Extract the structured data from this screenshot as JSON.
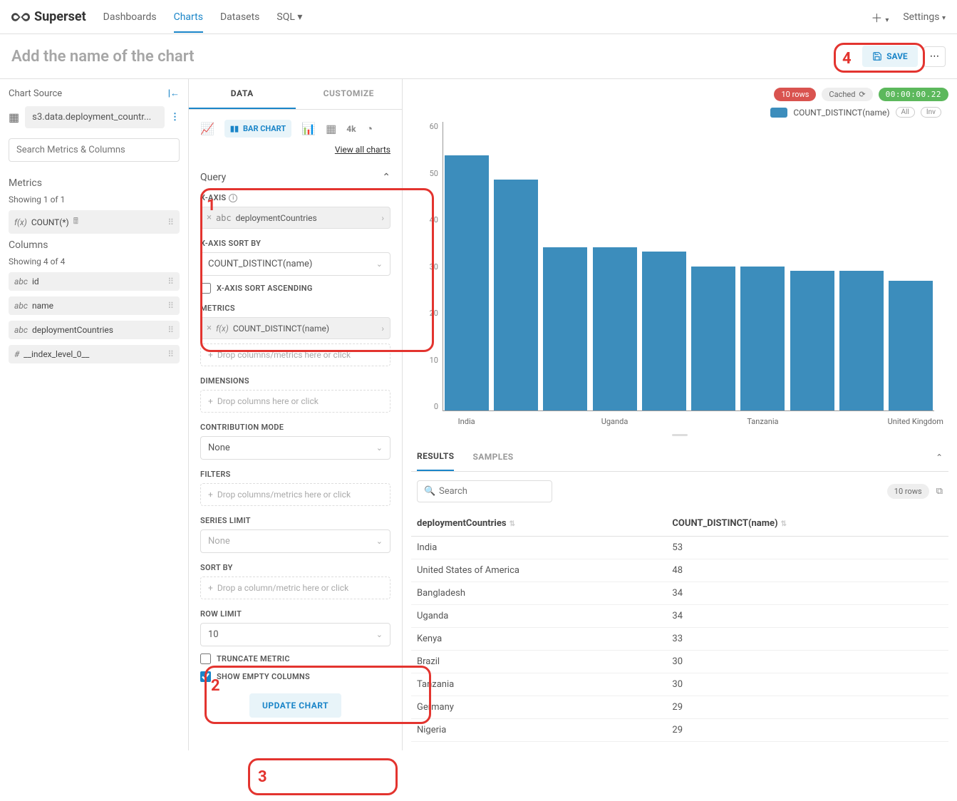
{
  "brand": "Superset",
  "nav": {
    "items": [
      "Dashboards",
      "Charts",
      "Datasets",
      "SQL"
    ],
    "active": "Charts",
    "settings": "Settings"
  },
  "title": "Add the name of the chart",
  "save_label": "SAVE",
  "source": {
    "header": "Chart Source",
    "dataset": "s3.data.deployment_countr...",
    "search_placeholder": "Search Metrics & Columns",
    "metrics_label": "Metrics",
    "metrics_hint": "Showing 1 of 1",
    "metrics": [
      {
        "type": "f(x)",
        "name": "COUNT(*)"
      }
    ],
    "columns_label": "Columns",
    "columns_hint": "Showing 4 of 4",
    "columns": [
      {
        "type": "abc",
        "name": "id"
      },
      {
        "type": "abc",
        "name": "name"
      },
      {
        "type": "abc",
        "name": "deploymentCountries"
      },
      {
        "type": "#",
        "name": "__index_level_0__"
      }
    ]
  },
  "config_tabs": {
    "data": "DATA",
    "customize": "CUSTOMIZE",
    "active": "DATA"
  },
  "viz": {
    "selected": "BAR CHART",
    "view_all": "View all charts"
  },
  "query": {
    "panel": "Query",
    "xaxis_label": "X-AXIS",
    "xaxis_value": "deploymentCountries",
    "xaxis_type": "abc",
    "sortby_label": "X-AXIS SORT BY",
    "sortby_value": "COUNT_DISTINCT(name)",
    "sort_asc_label": "X-AXIS SORT ASCENDING",
    "sort_asc_checked": false,
    "metrics_label": "METRICS",
    "metric_value": "COUNT_DISTINCT(name)",
    "metric_type": "f(x)",
    "metrics_drop": "Drop columns/metrics here or click",
    "dimensions_label": "DIMENSIONS",
    "dimensions_drop": "Drop columns here or click",
    "contrib_label": "CONTRIBUTION MODE",
    "contrib_value": "None",
    "filters_label": "FILTERS",
    "filters_drop": "Drop columns/metrics here or click",
    "series_label": "SERIES LIMIT",
    "series_value": "None",
    "sort_label": "SORT BY",
    "sort_drop": "Drop a column/metric here or click",
    "rowlimit_label": "ROW LIMIT",
    "rowlimit_value": "10",
    "truncate_label": "TRUNCATE METRIC",
    "truncate_checked": false,
    "showempty_label": "SHOW EMPTY COLUMNS",
    "showempty_checked": true,
    "update_btn": "UPDATE CHART"
  },
  "chart_status": {
    "rows": "10 rows",
    "cached": "Cached",
    "time": "00:00:00.22"
  },
  "legend": {
    "series": "COUNT_DISTINCT(name)",
    "pill_all": "All",
    "pill_inv": "Inv"
  },
  "chart_data": {
    "type": "bar",
    "categories": [
      "India",
      "United States of America",
      "Bangladesh",
      "Uganda",
      "Kenya",
      "Brazil",
      "Tanzania",
      "Germany",
      "Nigeria",
      "United Kingdom"
    ],
    "values": [
      53,
      48,
      34,
      34,
      33,
      30,
      30,
      29,
      29,
      27
    ],
    "x_label_shown": [
      "India",
      "",
      "",
      "Uganda",
      "",
      "",
      "Tanzania",
      "",
      "",
      "United Kingdom"
    ],
    "ylabel": "",
    "xlabel": "",
    "ylim": [
      0,
      60
    ],
    "yticks": [
      0,
      10,
      20,
      30,
      40,
      50,
      60
    ],
    "series_name": "COUNT_DISTINCT(name)"
  },
  "results": {
    "tabs": {
      "results": "RESULTS",
      "samples": "SAMPLES"
    },
    "search_placeholder": "Search",
    "rows_badge": "10 rows",
    "columns": [
      "deploymentCountries",
      "COUNT_DISTINCT(name)"
    ],
    "rows": [
      [
        "India",
        "53"
      ],
      [
        "United States of America",
        "48"
      ],
      [
        "Bangladesh",
        "34"
      ],
      [
        "Uganda",
        "34"
      ],
      [
        "Kenya",
        "33"
      ],
      [
        "Brazil",
        "30"
      ],
      [
        "Tanzania",
        "30"
      ],
      [
        "Germany",
        "29"
      ],
      [
        "Nigeria",
        "29"
      ]
    ]
  },
  "annotations": {
    "one": "1",
    "two": "2",
    "three": "3",
    "four": "4"
  }
}
